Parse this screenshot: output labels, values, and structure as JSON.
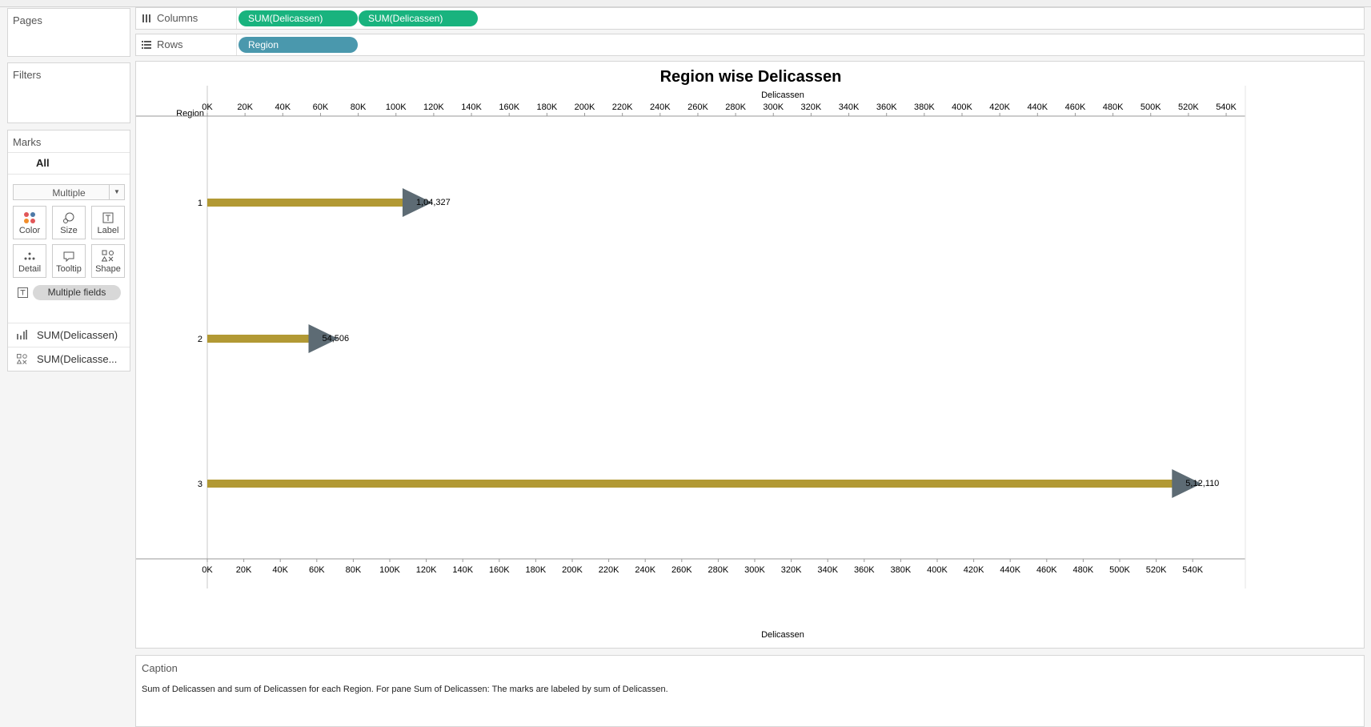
{
  "left_panels": {
    "pages_title": "Pages",
    "filters_title": "Filters",
    "marks_title": "Marks",
    "marks_all": "All",
    "marks_type": "Multiple",
    "mark_buttons": [
      "Color",
      "Size",
      "Label",
      "Detail",
      "Tooltip",
      "Shape"
    ],
    "multiple_fields_pill": "Multiple fields",
    "mark_tabs": [
      "SUM(Delicassen)",
      "SUM(Delicasse..."
    ]
  },
  "shelves": {
    "columns_label": "Columns",
    "rows_label": "Rows",
    "column_pills": [
      "SUM(Delicassen)",
      "SUM(Delicassen)"
    ],
    "row_pills": [
      "Region"
    ],
    "column_pill_color": "#19b37e",
    "row_pill_color": "#4a98ad"
  },
  "chart_data": {
    "type": "bar",
    "title": "Region wise Delicassen",
    "xlabel": "Delicassen",
    "ylabel": "Region",
    "categories": [
      "1",
      "2",
      "3"
    ],
    "values": [
      104327,
      54506,
      512110
    ],
    "data_labels": [
      "1,04,327",
      "54,506",
      "5,12,110"
    ],
    "xlim": [
      0,
      550000
    ],
    "x_ticks": [
      "0K",
      "20K",
      "40K",
      "60K",
      "80K",
      "100K",
      "120K",
      "140K",
      "160K",
      "180K",
      "200K",
      "220K",
      "240K",
      "260K",
      "280K",
      "300K",
      "320K",
      "340K",
      "360K",
      "380K",
      "400K",
      "420K",
      "440K",
      "460K",
      "480K",
      "500K",
      "520K",
      "540K"
    ],
    "bar_color": "#b29934",
    "shape_color": "#5d6b74",
    "top_axis": true,
    "bottom_axis": true
  },
  "caption": {
    "title": "Caption",
    "text": "Sum of Delicassen and sum of Delicassen for each Region.  For pane Sum of Delicassen:  The marks are labeled by sum of Delicassen."
  }
}
